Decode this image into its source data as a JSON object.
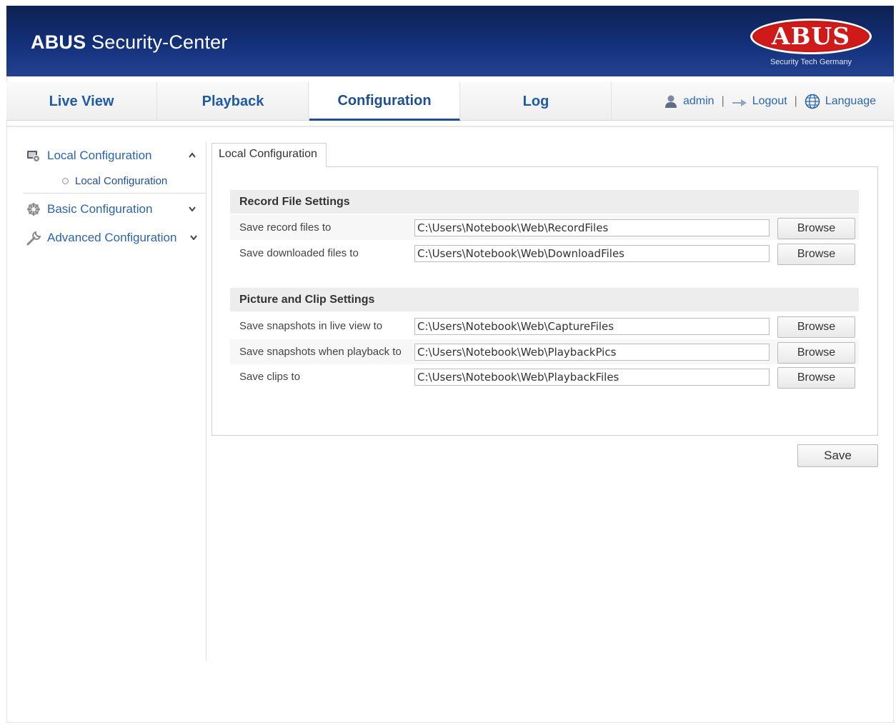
{
  "header": {
    "brand": "ABUS",
    "title": "Security-Center",
    "logo_text": "ABUS",
    "logo_tagline": "Security Tech Germany"
  },
  "nav": {
    "tabs": [
      {
        "label": "Live View"
      },
      {
        "label": "Playback"
      },
      {
        "label": "Configuration",
        "active": true
      },
      {
        "label": "Log"
      }
    ],
    "user": "admin",
    "logout": "Logout",
    "language": "Language",
    "separator": "|"
  },
  "sidebar": {
    "items": [
      {
        "label": "Local Configuration",
        "icon": "local-config-icon",
        "expanded": true,
        "caret": "^"
      },
      {
        "label": "Basic Configuration",
        "icon": "gear-icon",
        "caret": "v"
      },
      {
        "label": "Advanced Configuration",
        "icon": "wrench-icon",
        "caret": "v"
      }
    ],
    "sub_items": [
      {
        "label": "Local Configuration"
      }
    ]
  },
  "content": {
    "tab": "Local Configuration",
    "sections": [
      {
        "title": "Record File Settings",
        "rows": [
          {
            "label": "Save record files to",
            "value": "C:\\Users\\Notebook\\Web\\RecordFiles",
            "button": "Browse"
          },
          {
            "label": "Save downloaded files to",
            "value": "C:\\Users\\Notebook\\Web\\DownloadFiles",
            "button": "Browse"
          }
        ]
      },
      {
        "title": "Picture and Clip Settings",
        "rows": [
          {
            "label": "Save snapshots in live view to",
            "value": "C:\\Users\\Notebook\\Web\\CaptureFiles",
            "button": "Browse"
          },
          {
            "label": "Save snapshots when playback to",
            "value": "C:\\Users\\Notebook\\Web\\PlaybackPics",
            "button": "Browse"
          },
          {
            "label": "Save clips to",
            "value": "C:\\Users\\Notebook\\Web\\PlaybackFiles",
            "button": "Browse"
          }
        ]
      }
    ],
    "save_label": "Save"
  },
  "colors": {
    "banner": "#13307a",
    "nav_text": "#1d5aa8",
    "logo_red": "#d01a1a"
  }
}
